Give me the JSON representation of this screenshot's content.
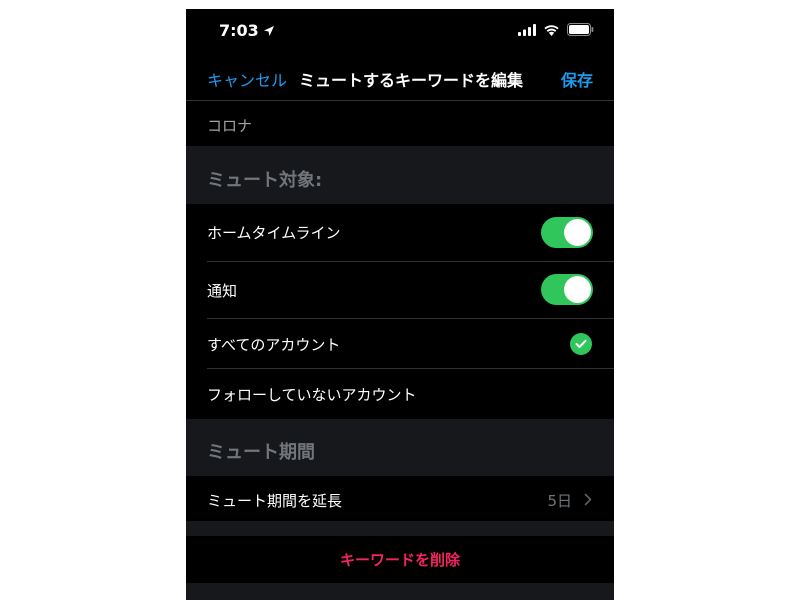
{
  "status_bar": {
    "time": "7:03"
  },
  "nav": {
    "cancel_label": "キャンセル",
    "title": "ミュートするキーワードを編集",
    "save_label": "保存"
  },
  "keyword": {
    "value": "コロナ"
  },
  "mute_target_section": {
    "header": "ミュート対象:",
    "rows": [
      {
        "label": "ホームタイムライン",
        "enabled": true
      },
      {
        "label": "通知",
        "enabled": true
      }
    ]
  },
  "audience": {
    "options": [
      {
        "label": "すべてのアカウント",
        "selected": true
      },
      {
        "label": "フォローしていないアカウント",
        "selected": false
      }
    ]
  },
  "duration_section": {
    "header": "ミュート期間",
    "row_label": "ミュート期間を延長",
    "row_value": "5日"
  },
  "delete": {
    "label": "キーワードを削除"
  },
  "colors": {
    "accent": "#1d9bf0",
    "toggle_on": "#30c65c",
    "destructive": "#f4245e",
    "background": "#000000",
    "section_bg": "#16181c"
  }
}
